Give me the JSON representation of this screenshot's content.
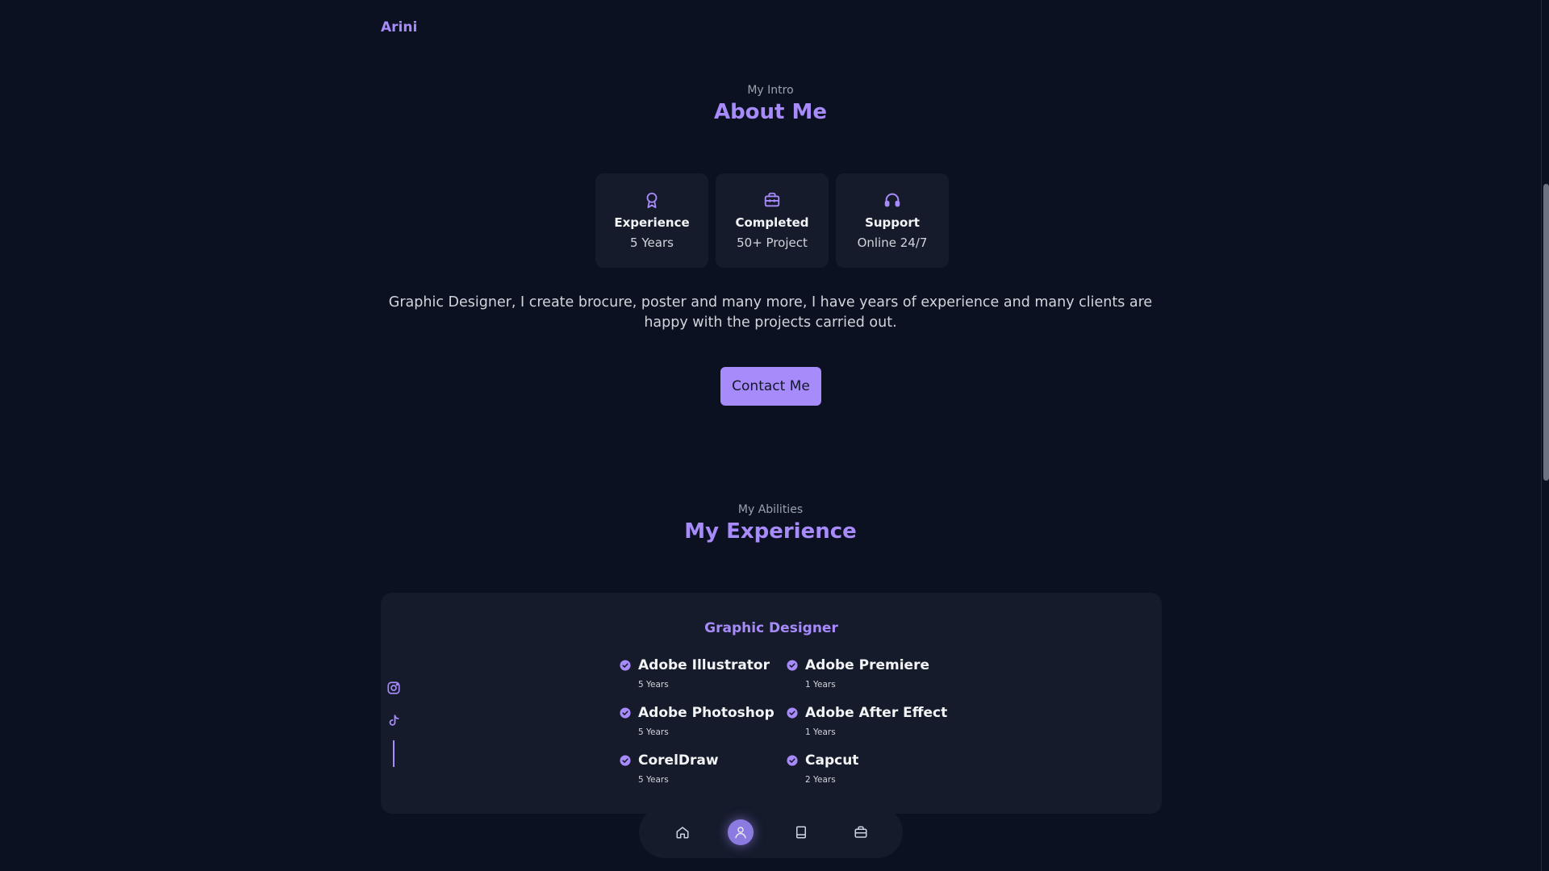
{
  "header": {
    "logo": "Arini"
  },
  "about": {
    "subtitle": "My Intro",
    "title": "About Me",
    "cards": [
      {
        "icon": "award-icon",
        "title": "Experience",
        "value": "5 Years"
      },
      {
        "icon": "briefcase-icon",
        "title": "Completed",
        "value": "50+ Project"
      },
      {
        "icon": "headset-icon",
        "title": "Support",
        "value": "Online 24/7"
      }
    ],
    "description": "Graphic Designer, I create brocure, poster and many more, I have years of experience and many clients are happy with the projects carried out.",
    "contact_label": "Contact Me"
  },
  "experience": {
    "subtitle": "My Abilities",
    "title": "My Experience",
    "panel_title": "Graphic Designer",
    "skills": [
      {
        "name": "Adobe Illustrator",
        "years": "5 Years"
      },
      {
        "name": "Adobe Premiere",
        "years": "1 Years"
      },
      {
        "name": "Adobe Photoshop",
        "years": "5 Years"
      },
      {
        "name": "Adobe After Effect",
        "years": "1 Years"
      },
      {
        "name": "CorelDraw",
        "years": "5 Years"
      },
      {
        "name": "Capcut",
        "years": "2 Years"
      }
    ]
  },
  "social": [
    "instagram-icon",
    "tiktok-icon"
  ],
  "bottom_nav": {
    "items": [
      "home-icon",
      "user-icon",
      "book-icon",
      "briefcase-icon"
    ],
    "active": "user-icon"
  },
  "colors": {
    "accent": "#a78bfa",
    "background": "#0b1120",
    "card": "#151b2b"
  }
}
